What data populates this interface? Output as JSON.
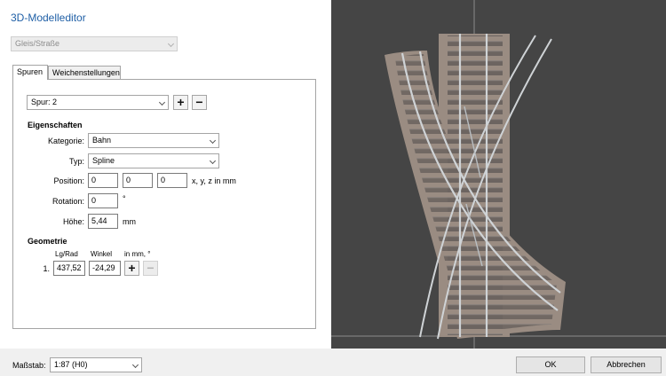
{
  "window": {
    "title": "3D-Modelleditor"
  },
  "object_type": {
    "value": "Gleis/Straße"
  },
  "tabs": [
    {
      "label": "Spuren",
      "active": true
    },
    {
      "label": "Weichenstellungen",
      "active": false
    }
  ],
  "spur": {
    "select_value": "Spur: 2",
    "add_label": "+",
    "remove_label": "−"
  },
  "properties": {
    "heading": "Eigenschaften",
    "kategorie_label": "Kategorie:",
    "kategorie_value": "Bahn",
    "typ_label": "Typ:",
    "typ_value": "Spline",
    "position_label": "Position:",
    "position_x": "0",
    "position_y": "0",
    "position_z": "0",
    "position_unit": "x, y, z in mm",
    "rotation_label": "Rotation:",
    "rotation_value": "0",
    "rotation_unit": "°",
    "hoehe_label": "Höhe:",
    "hoehe_value": "5,44",
    "hoehe_unit": "mm"
  },
  "geometry": {
    "heading": "Geometrie",
    "col_length": "Lg/Rad",
    "col_angle": "Winkel",
    "col_unit": "in mm, °",
    "rows": [
      {
        "index": "1.",
        "length": "437,52",
        "angle": "-24,29"
      }
    ],
    "add_label": "+",
    "remove_label": "−"
  },
  "footer": {
    "scale_label": "Maßstab:",
    "scale_value": "1:87 (H0)",
    "ok_label": "OK",
    "cancel_label": "Abbrechen"
  },
  "viewport": {
    "background": "#454545",
    "ballast_color": "#9a8c82",
    "rail_color": "#cfd3d6"
  }
}
